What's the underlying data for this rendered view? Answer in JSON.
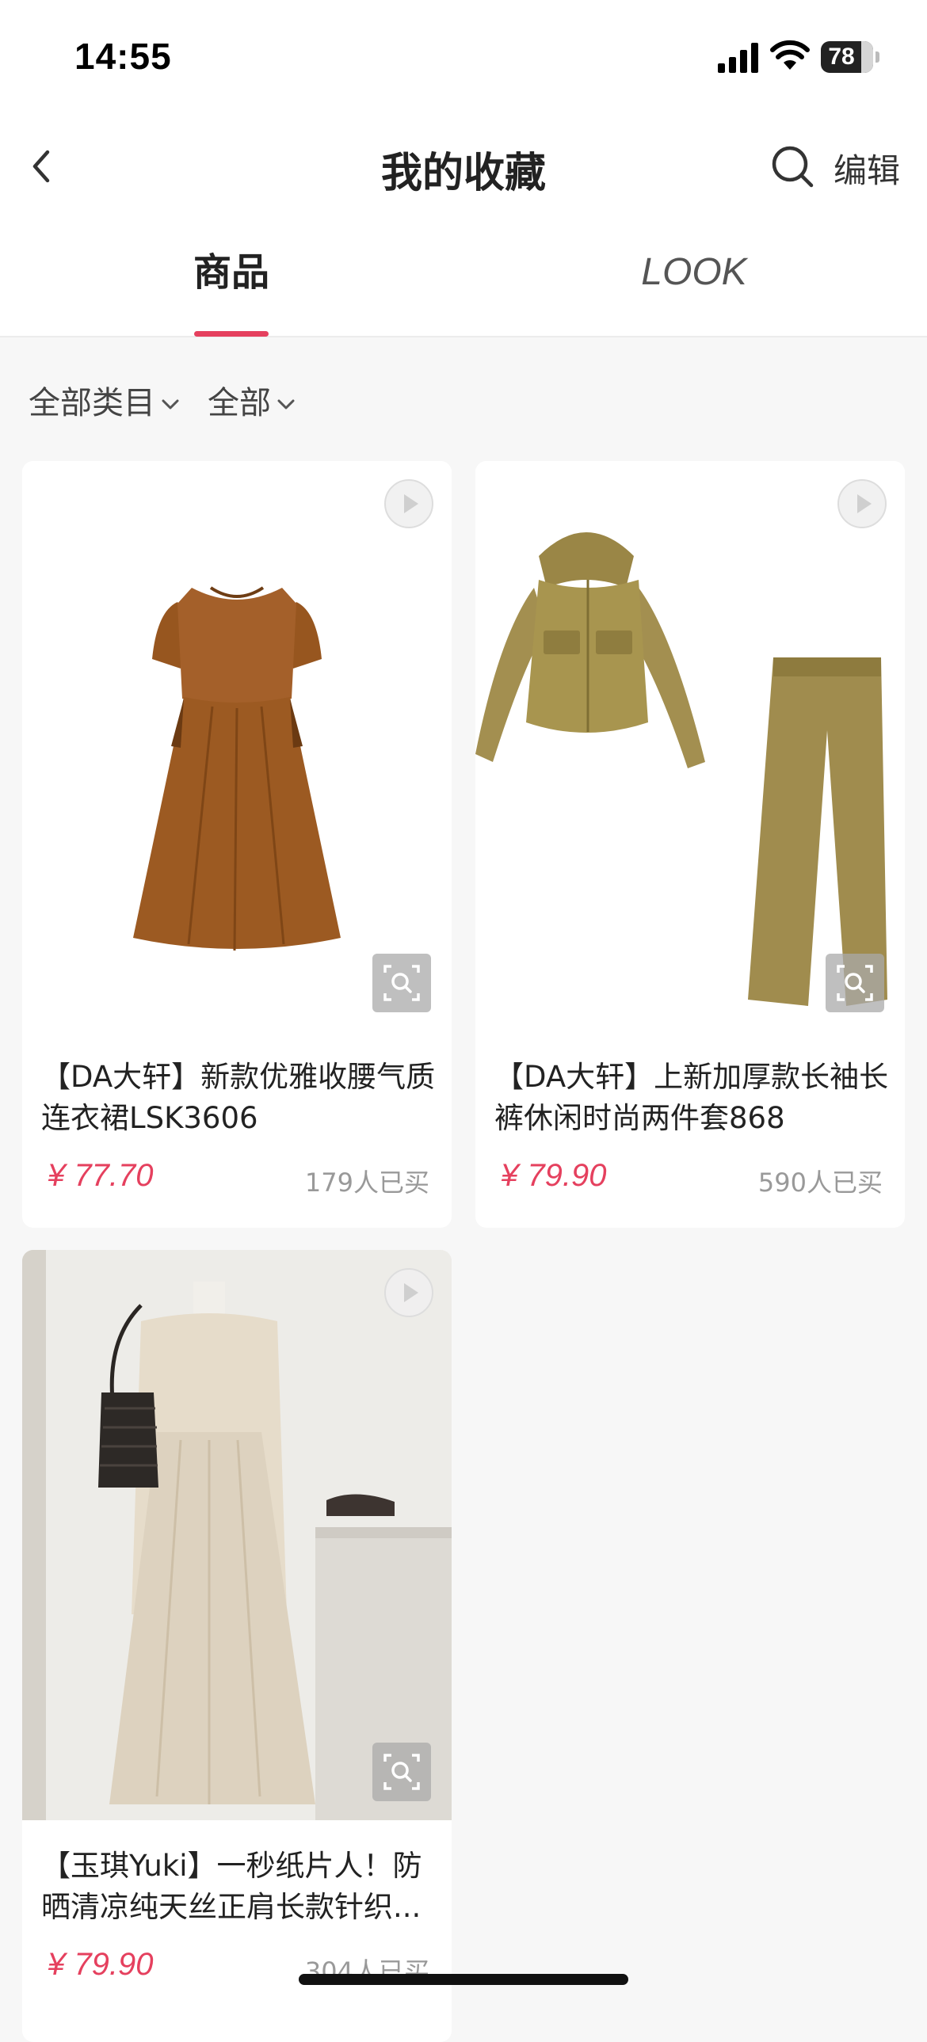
{
  "status_bar": {
    "time": "14:55",
    "battery_level": "78",
    "battery_fraction": 0.78
  },
  "nav": {
    "title": "我的收藏",
    "edit_label": "编辑"
  },
  "tabs": [
    {
      "label": "商品",
      "active": true
    },
    {
      "label": "LOOK",
      "active": false
    }
  ],
  "filters": {
    "category_label": "全部类目",
    "scope_label": "全部"
  },
  "colors": {
    "accent": "#e5405e",
    "price": "#e5405e",
    "text_primary": "#222222",
    "text_muted": "#999999",
    "background": "#f7f7f7"
  },
  "products": [
    {
      "title": "【DA大轩】新款优雅收腰气质连衣裙LSK3606",
      "price": "¥ 77.70",
      "sold": "179人已买",
      "image_icon": "brown-dress-image"
    },
    {
      "title": "【DA大轩】上新加厚款长袖长裤休闲时尚两件套868",
      "price": "¥ 79.90",
      "sold": "590人已买",
      "image_icon": "hoodie-and-pants-set-image"
    },
    {
      "title": "【玉琪Yuki】一秒纸片人！防晒清凉纯天丝正肩长款针织...",
      "price": "¥ 79.90",
      "sold": "304人已买",
      "image_icon": "cardigan-outfit-photo"
    }
  ]
}
